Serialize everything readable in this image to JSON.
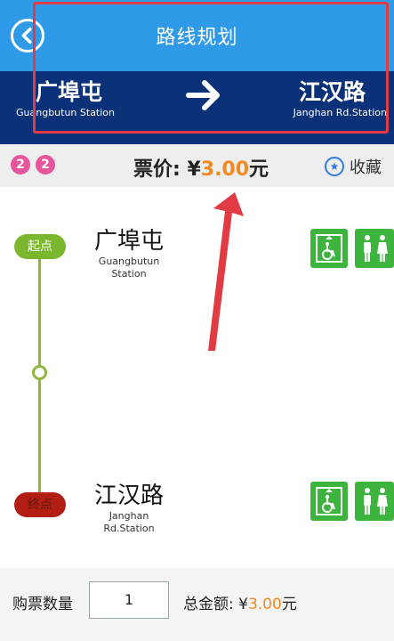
{
  "header": {
    "title": "路线规划"
  },
  "route": {
    "from_cn": "广埠屯",
    "from_en": "Guangbutun Station",
    "to_cn": "江汉路",
    "to_en": "Janghan Rd.Station"
  },
  "fare": {
    "badges": [
      "2",
      "2"
    ],
    "label": "票价: ¥",
    "amount": "3.00",
    "unit": "元",
    "favorite_label": "收藏"
  },
  "stations": {
    "start_pill": "起点",
    "start_cn": "广埠屯",
    "start_en_line1": "Guangbutun",
    "start_en_line2": "Station",
    "end_pill": "终点",
    "end_cn": "江汉路",
    "end_en_line1": "Janghan",
    "end_en_line2": "Rd.Station"
  },
  "purchase": {
    "qty_label": "购票数量",
    "qty_value": "1",
    "total_label": "总金额: ¥",
    "total_amount": "3.00",
    "total_unit": "元"
  },
  "colors": {
    "header_blue": "#2f9ae8",
    "route_navy": "#0b3179",
    "fare_orange": "#f08a24",
    "line_pink": "#e7569b",
    "start_green": "#7ab72d",
    "end_red": "#b21d14",
    "facility_green": "#3db43d"
  },
  "icons": [
    "back-icon",
    "arrow-right-icon",
    "favorite-star-icon",
    "elevator-accessible-icon",
    "restroom-icon"
  ]
}
